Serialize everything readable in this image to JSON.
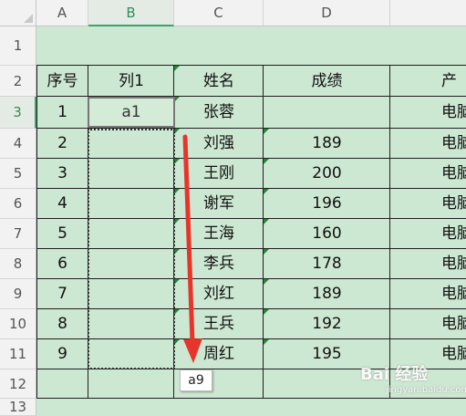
{
  "columns": [
    "A",
    "B",
    "C",
    "D"
  ],
  "rows": [
    "1",
    "2",
    "3",
    "4",
    "5",
    "6",
    "7",
    "8",
    "9",
    "10",
    "11",
    "12",
    "13"
  ],
  "headers": {
    "seq": "序号",
    "col1": "列1",
    "name": "姓名",
    "score": "成绩",
    "partial": "产"
  },
  "table_rows": [
    {
      "seq": "1",
      "col1": "a1",
      "name": "张蓉",
      "score": "",
      "dept": "电脑"
    },
    {
      "seq": "2",
      "col1": "",
      "name": "刘强",
      "score": "189",
      "dept": "电脑"
    },
    {
      "seq": "3",
      "col1": "",
      "name": "王刚",
      "score": "200",
      "dept": "电脑"
    },
    {
      "seq": "4",
      "col1": "",
      "name": "谢军",
      "score": "196",
      "dept": "电脑"
    },
    {
      "seq": "5",
      "col1": "",
      "name": "王海",
      "score": "160",
      "dept": "电脑"
    },
    {
      "seq": "6",
      "col1": "",
      "name": "李兵",
      "score": "178",
      "dept": "电脑"
    },
    {
      "seq": "7",
      "col1": "",
      "name": "刘红",
      "score": "189",
      "dept": "电脑"
    },
    {
      "seq": "8",
      "col1": "",
      "name": "王兵",
      "score": "192",
      "dept": "电脑"
    },
    {
      "seq": "9",
      "col1": "",
      "name": "周红",
      "score": "195",
      "dept": "电脑"
    }
  ],
  "fill_tooltip": "a9",
  "watermark": {
    "text": "Bai 经验",
    "sub": "jingyan.baidu.com"
  },
  "colors": {
    "sheet_bg": "#cde8d2",
    "accent": "#3ba36b",
    "arrow": "#e8352b"
  },
  "active_cell": "B3"
}
